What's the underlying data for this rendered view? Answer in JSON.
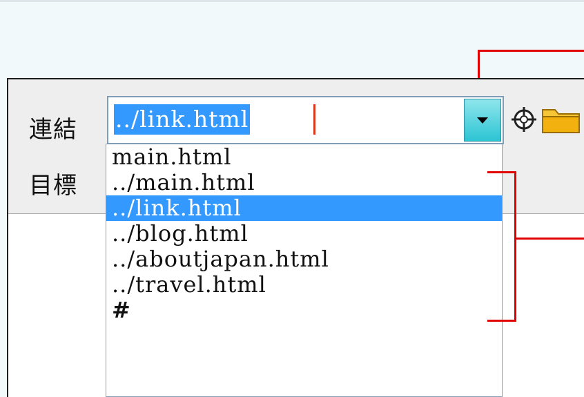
{
  "form": {
    "link_label": "連結",
    "target_label": "目標",
    "link_value": "../link.html"
  },
  "dropdown": {
    "options": [
      "main.html",
      "../main.html",
      "../link.html",
      "../blog.html",
      "../aboutjapan.html",
      "../travel.html",
      "#"
    ],
    "selected_index": 2
  },
  "icons": {
    "combo_arrow": "chevron-down-icon",
    "point_to_file": "crosshair-target-icon",
    "browse_folder": "folder-icon"
  },
  "colors": {
    "selection": "#3399ff",
    "callout": "#e00000",
    "combo_button": "#2cc4d4",
    "folder": "#f2b10f"
  }
}
